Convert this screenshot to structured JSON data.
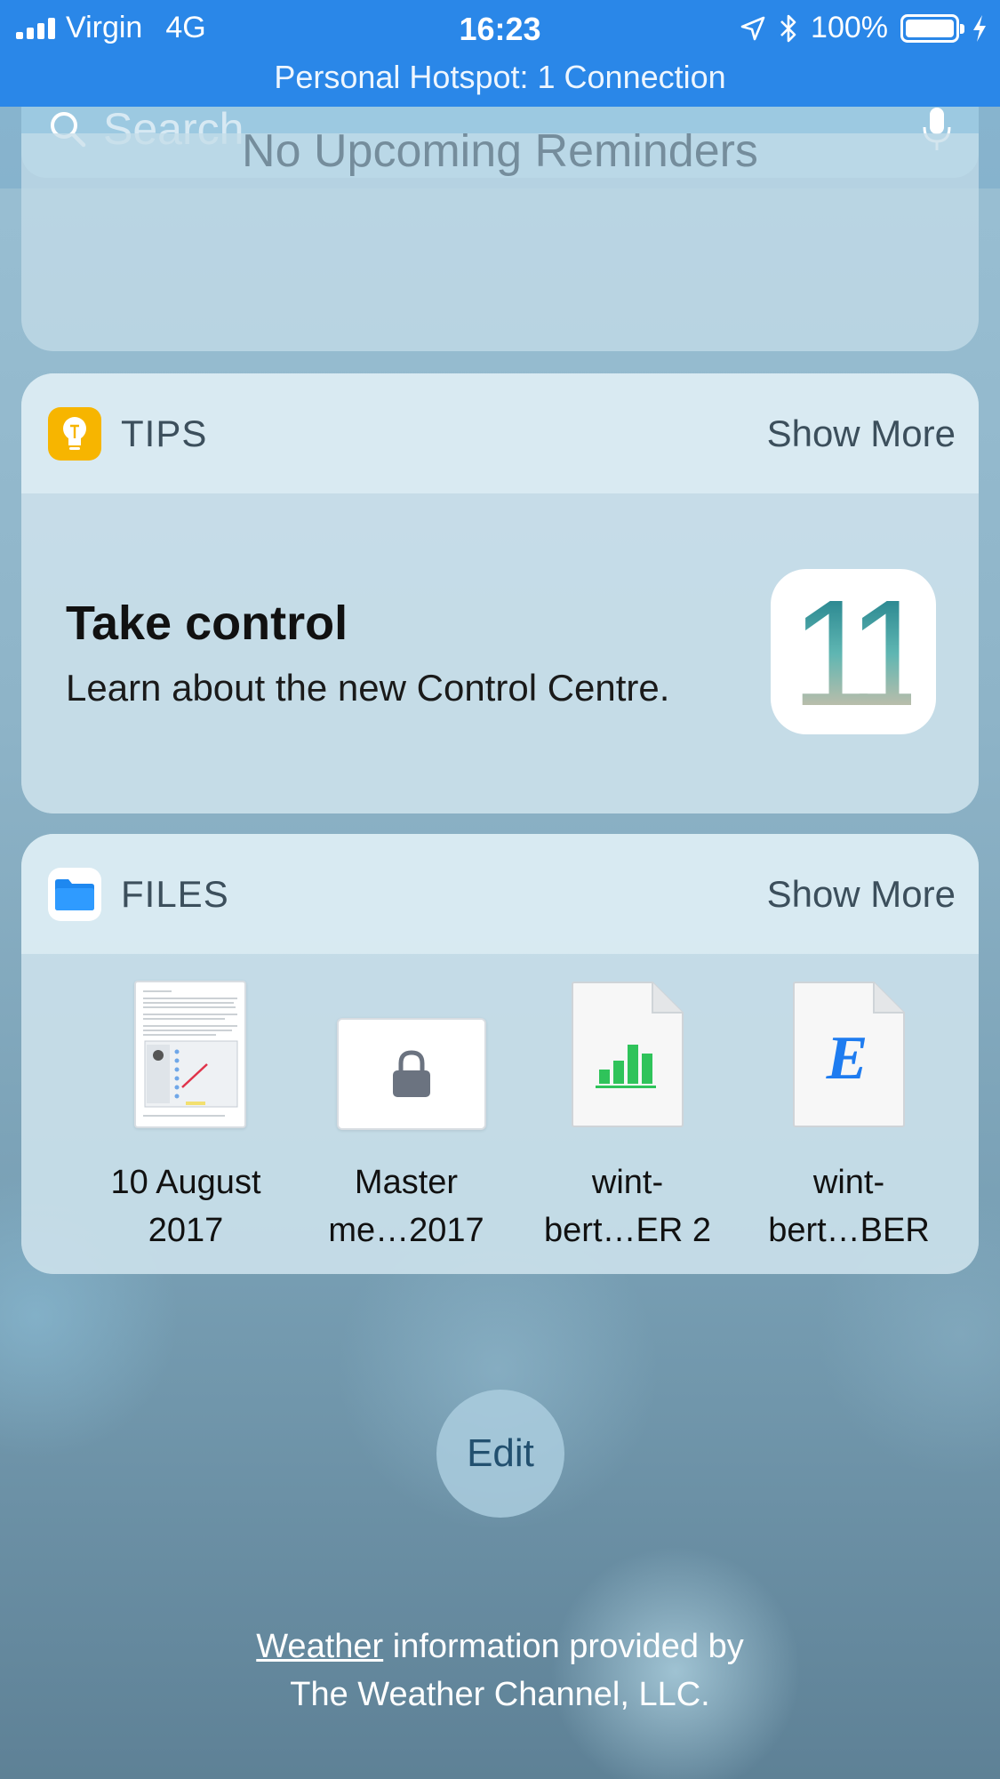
{
  "status_bar": {
    "carrier": "Virgin",
    "network": "4G",
    "time": "16:23",
    "battery": "100%",
    "hotspot": "Personal Hotspot: 1 Connection",
    "background_color": "#2a87e8"
  },
  "search": {
    "placeholder": "Search"
  },
  "reminders": {
    "message": "No Upcoming Reminders"
  },
  "tips": {
    "title": "TIPS",
    "show_more": "Show More",
    "tip_title": "Take control",
    "tip_subtitle": "Learn about the new Control Centre.",
    "icon": "lightbulb-icon",
    "badge": "11",
    "icon_color": "#f7b500"
  },
  "files": {
    "title": "FILES",
    "show_more": "Show More",
    "icon": "folder-icon",
    "items": [
      {
        "line1": "10 August",
        "line2": "2017",
        "type": "document-thumbnail"
      },
      {
        "line1": "Master",
        "line2": "me…2017",
        "type": "locked-document"
      },
      {
        "line1": "wint-",
        "line2": "bert…ER 2",
        "type": "numbers-document"
      },
      {
        "line1": "wint-",
        "line2": "bert…BER",
        "type": "text-document"
      }
    ]
  },
  "edit": {
    "label": "Edit"
  },
  "footer": {
    "link": "Weather",
    "text": " information provided by",
    "line2": "The Weather Channel, LLC."
  }
}
